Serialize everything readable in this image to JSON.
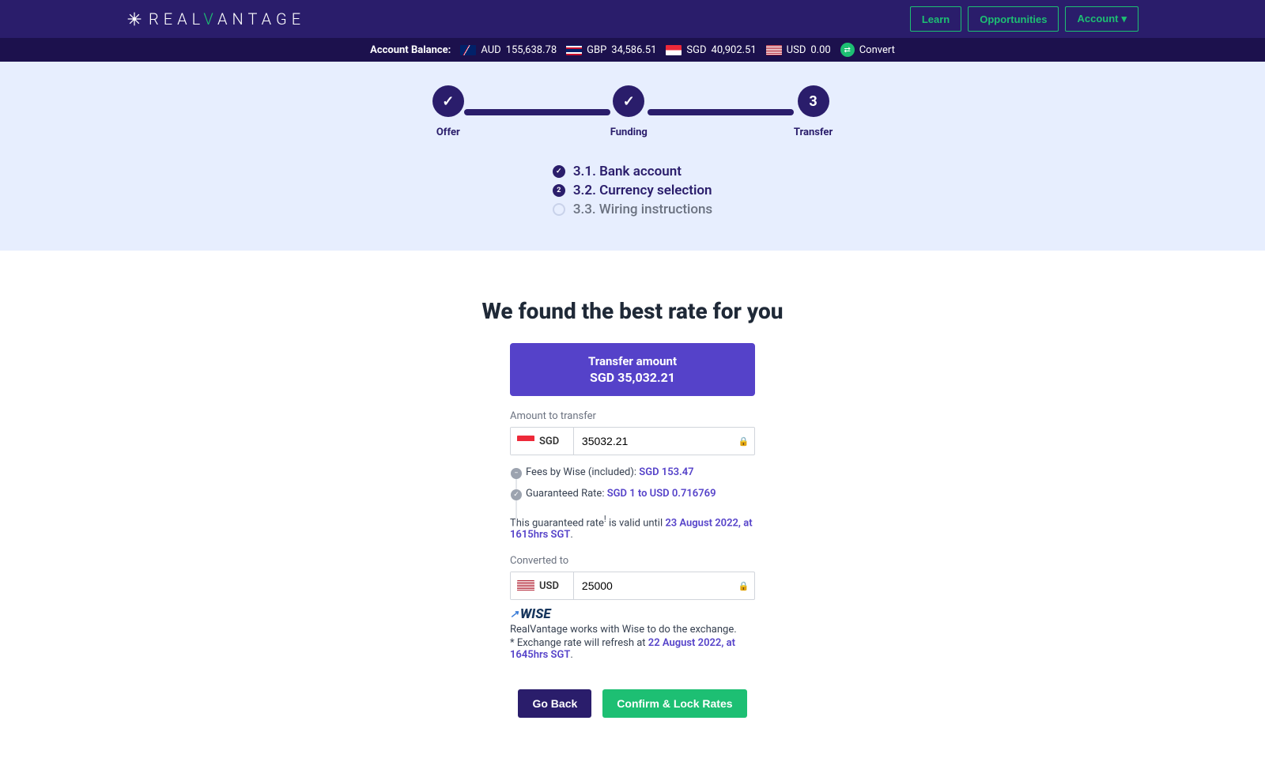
{
  "brand": {
    "name_pre": "REAL",
    "name_accent": "V",
    "name_post": "ANTAGE"
  },
  "nav": {
    "learn": "Learn",
    "opportunities": "Opportunities",
    "account": "Account"
  },
  "balance": {
    "label": "Account Balance:",
    "items": [
      {
        "currency": "AUD",
        "amount": "155,638.78"
      },
      {
        "currency": "GBP",
        "amount": "34,586.51"
      },
      {
        "currency": "SGD",
        "amount": "40,902.51"
      },
      {
        "currency": "USD",
        "amount": "0.00"
      }
    ],
    "convert": "Convert"
  },
  "steps": {
    "s1": "Offer",
    "s2": "Funding",
    "s3": "Transfer",
    "s3_num": "3"
  },
  "substeps": {
    "a": "3.1. Bank account",
    "b": "3.2. Currency selection",
    "c": "3.3. Wiring instructions"
  },
  "content": {
    "headline": "We found the best rate for you",
    "banner_label": "Transfer amount",
    "banner_amount": "SGD 35,032.21",
    "amount_to_transfer_label": "Amount to transfer",
    "from_currency": "SGD",
    "from_value": "35032.21",
    "fees_prefix": "Fees by Wise (included): ",
    "fees_value": "SGD 153.47",
    "rate_prefix": "Guaranteed Rate: ",
    "rate_value": "SGD 1 to USD 0.716769",
    "guarantee_prefix": "This guaranteed rate",
    "guarantee_mid": " is valid until ",
    "guarantee_date": "23 August 2022, at 1615hrs SGT",
    "guarantee_suffix": ".",
    "converted_label": "Converted to",
    "to_currency": "USD",
    "to_value": "25000",
    "wise_name": "WISE",
    "wise_desc": "RealVantage works with Wise to do the exchange.",
    "refresh_prefix": "* Exchange rate will refresh at ",
    "refresh_date": "22 August 2022, at 1645hrs SGT",
    "refresh_suffix": "."
  },
  "actions": {
    "back": "Go Back",
    "confirm": "Confirm & Lock Rates"
  }
}
